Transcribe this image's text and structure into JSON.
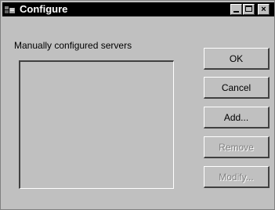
{
  "window": {
    "title": "Configure",
    "controls": {
      "minimize": "_",
      "maximize": "□",
      "close": "×"
    }
  },
  "main": {
    "servers_label": "Manually configured servers",
    "servers": []
  },
  "buttons": {
    "ok": "OK",
    "cancel": "Cancel",
    "add": "Add...",
    "remove": "Remove",
    "modify": "Modify..."
  },
  "icons": {
    "title_icon": "network-servers-icon"
  },
  "colors": {
    "titlebar": "#000000",
    "face": "#c0c0c0",
    "disabled_text": "#808080"
  }
}
